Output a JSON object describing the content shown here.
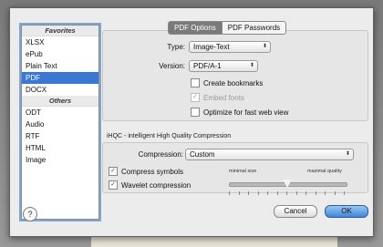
{
  "sidebar": {
    "favorites_header": "Favorites",
    "favorites": [
      "XLSX",
      "ePub",
      "Plain Text",
      "PDF",
      "DOCX"
    ],
    "others_header": "Others",
    "others": [
      "ODT",
      "Audio",
      "RTF",
      "HTML",
      "Image"
    ],
    "selected": "PDF"
  },
  "tabs": [
    "PDF Options",
    "PDF Passwords"
  ],
  "pdf_options": {
    "type_label": "Type:",
    "type_value": "Image-Text",
    "version_label": "Version:",
    "version_value": "PDF/A-1",
    "create_bookmarks": "Create bookmarks",
    "embed_fonts": "Embed fonts",
    "optimize": "Optimize for fast web view"
  },
  "ihqc": {
    "title": "iHQC - intelligent High Quality Compression",
    "compression_label": "Compression:",
    "compression_value": "Custom",
    "compress_symbols": "Compress symbols",
    "wavelet": "Wavelet compression",
    "min_size": "minimal size",
    "max_quality": "maximal quality",
    "slider_level": 0.5
  },
  "buttons": {
    "help": "?",
    "cancel": "Cancel",
    "ok": "OK"
  },
  "colors": {
    "selection": "#3a78d4",
    "ok_button": "#3d86d9",
    "check": "#1a4fa8"
  }
}
